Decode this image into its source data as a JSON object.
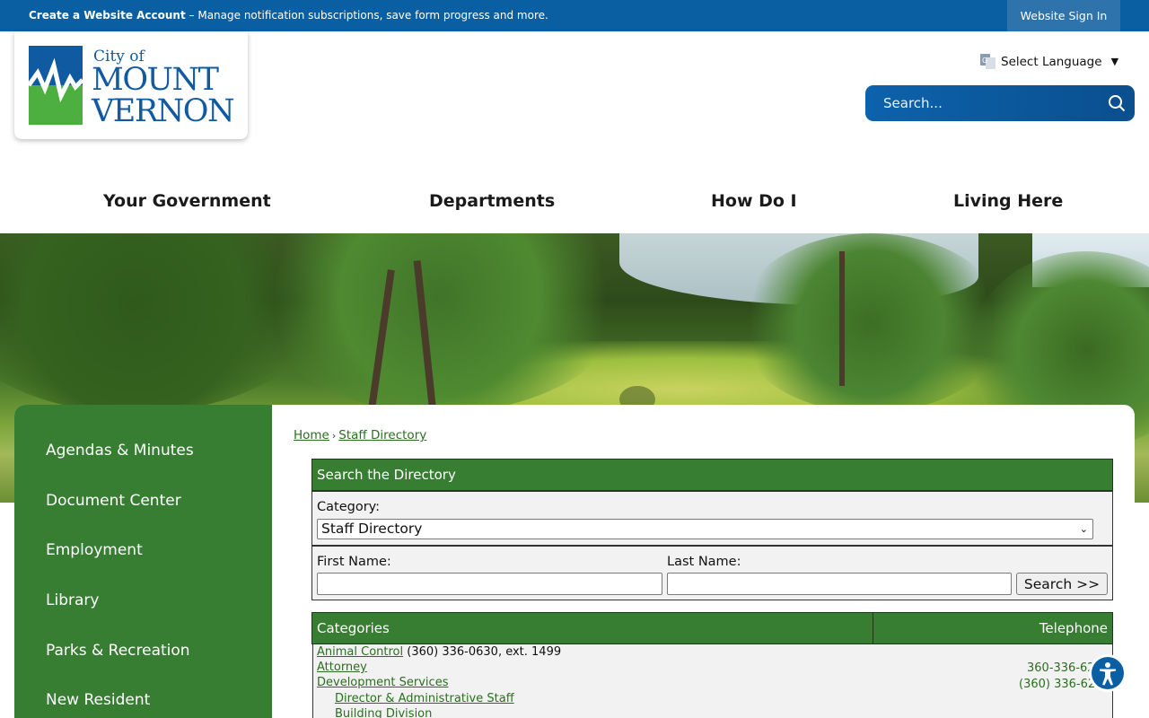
{
  "topbar": {
    "create_account": "Create a Website Account",
    "create_account_desc": " – Manage notification subscriptions, save form progress and more.",
    "signin": "Website Sign In"
  },
  "logo": {
    "city_of": "City of",
    "line1": "MOUNT",
    "line2": "VERNON",
    "colors": {
      "blue": "#0f5aa0",
      "green": "#4caf3f"
    }
  },
  "header": {
    "language_label": "Select Language",
    "search_placeholder": "Search..."
  },
  "nav": {
    "items": [
      "Your Government",
      "Departments",
      "How Do I",
      "Living Here"
    ]
  },
  "sidebar": {
    "items": [
      "Agendas & Minutes",
      "Document Center",
      "Employment",
      "Library",
      "Parks & Recreation",
      "New Resident"
    ]
  },
  "breadcrumb": {
    "home": "Home",
    "separator": "›",
    "current": "Staff Directory"
  },
  "directory": {
    "search_title": "Search the Directory",
    "category_label": "Category:",
    "category_value": "Staff Directory",
    "first_name_label": "First Name:",
    "last_name_label": "Last Name:",
    "search_button": "Search >>",
    "categories_header": "Categories",
    "telephone_header": "Telephone",
    "rows": [
      {
        "name": "Animal Control",
        "inline_phone": "(360) 336-0630, ext. 1499"
      },
      {
        "name": "Attorney",
        "phone": "360-336-62"
      },
      {
        "name": "Development Services",
        "phone": "(360) 336-62"
      },
      {
        "name": "Director & Administrative Staff"
      },
      {
        "name": "Building Division"
      }
    ]
  },
  "colors": {
    "topbar": "#0a5fa3",
    "accent_green": "#377e33",
    "link_green": "#2b6e1f"
  }
}
